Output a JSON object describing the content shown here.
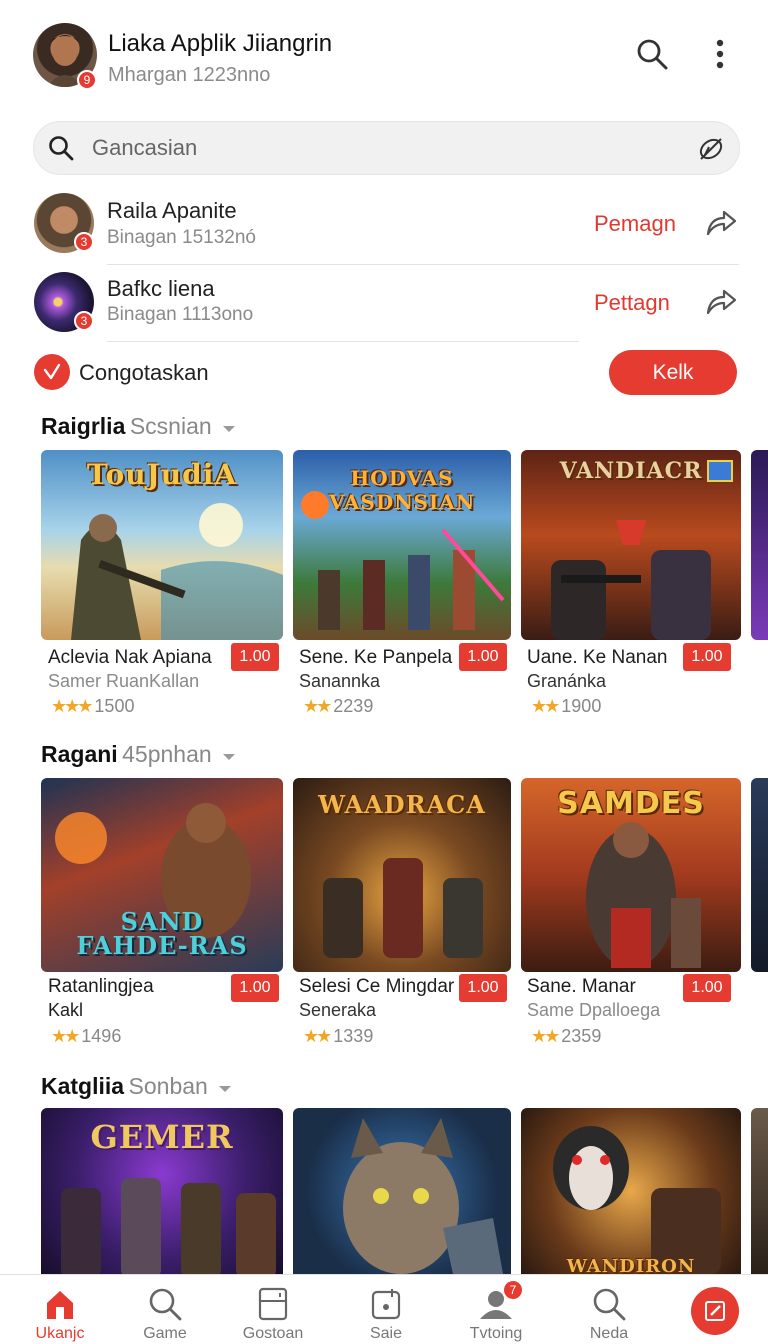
{
  "header": {
    "title": "Liaka Apþlik Jiiangrin",
    "subtitle": "Mhargan 1223nno",
    "avatar_badge": "9"
  },
  "search": {
    "placeholder": "Gancasian"
  },
  "friends": [
    {
      "name": "Raila Apanite",
      "sub": "Binagan 15132nó",
      "action": "Pemagn",
      "badge": "3"
    },
    {
      "name": "Bafkc liena",
      "sub": "Binagan 1113ono",
      "action": "Pettagn",
      "badge": "3"
    }
  ],
  "confirm": {
    "label": "Congotaskan",
    "button": "Kelk"
  },
  "sections": [
    {
      "title": "Raigrlia",
      "subtitle": "Scsnian",
      "cards": [
        {
          "title": "Aclevia Nak Apiana",
          "sub": "Samer RuanKallan",
          "price": "1.00",
          "rating": "1500",
          "stars": "★★★",
          "art": "TouJudiA"
        },
        {
          "title": "Sene. Ke Panpela",
          "sub": "Sanannka",
          "price": "1.00",
          "rating": "2239",
          "stars": "★★",
          "art": "HODVAS VASDNSIAN"
        },
        {
          "title": "Uane. Ke Nanan",
          "sub": "Granánka",
          "price": "1.00",
          "rating": "1900",
          "stars": "★★",
          "art": "VANDIACR"
        }
      ]
    },
    {
      "title": "Ragani",
      "subtitle": "45pnhan",
      "cards": [
        {
          "title": "Ratanlingjea",
          "sub": "Kakl",
          "price": "1.00",
          "rating": "1496",
          "stars": "★★",
          "art": "SAND FAHDE-RAS"
        },
        {
          "title": "Selesi Ce Mingdar",
          "sub": "Seneraka",
          "price": "1.00",
          "rating": "1339",
          "stars": "★★",
          "art": "WAADRACA"
        },
        {
          "title": "Sane. Manar",
          "sub": "Same Dpalloega",
          "price": "1.00",
          "rating": "2359",
          "stars": "★★",
          "art": "SAMDES"
        }
      ]
    },
    {
      "title": "Katgliia",
      "subtitle": "Sonban",
      "cards": [
        {
          "art": "GEMER"
        },
        {
          "art": ""
        },
        {
          "art": "WANDIRON"
        }
      ]
    }
  ],
  "bottom_nav": [
    {
      "label": "Ukanjc",
      "icon": "home-icon",
      "active": true
    },
    {
      "label": "Game",
      "icon": "search-icon"
    },
    {
      "label": "Gostoan",
      "icon": "fridge-icon"
    },
    {
      "label": "Saie",
      "icon": "download-box-icon"
    },
    {
      "label": "Tvtoing",
      "icon": "user-group-icon",
      "badge": "7"
    },
    {
      "label": "Neda",
      "icon": "search-icon"
    }
  ],
  "colors": {
    "accent": "#e53b30",
    "muted": "#8a8a8a"
  }
}
